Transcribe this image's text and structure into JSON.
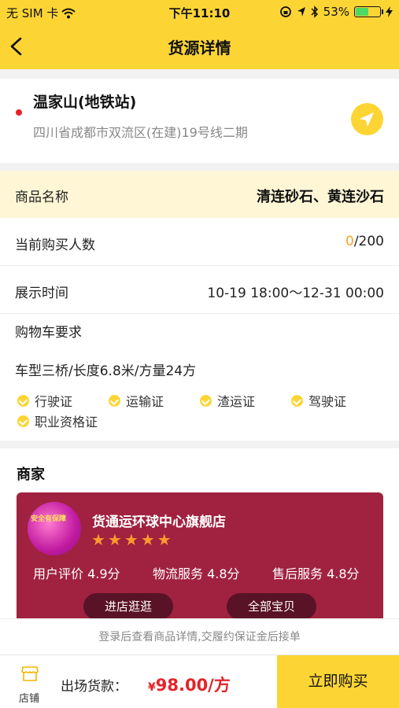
{
  "status_bar": {
    "carrier": "无 SIM 卡",
    "time": "下午11:10",
    "battery": "53%",
    "battery_level": 0.53
  },
  "nav": {
    "title": "货源详情"
  },
  "location": {
    "name": "温家山(地铁站)",
    "address": "四川省成都市双流区(在建)19号线二期"
  },
  "details": {
    "product_label": "商品名称",
    "product_value": "清连砂石、黄连沙石",
    "buyers_label": "当前购买人数",
    "buyers_current": "0",
    "buyers_total": "/200",
    "time_label": "展示时间",
    "time_value": "10-19 18:00～12-31 00:00"
  },
  "cart": {
    "title": "购物车要求",
    "spec": "车型三桥/长度6.8米/方量24方",
    "certs": [
      "行驶证",
      "运输证",
      "渣运证",
      "驾驶证",
      "职业资格证"
    ]
  },
  "merchant": {
    "section_title": "商家",
    "shop_name": "货通运环球中心旗舰店",
    "avatar_text": "安全有保障",
    "stars": 5,
    "ratings": [
      "用户评价 4.9分",
      "物流服务 4.8分",
      "售后服务 4.8分"
    ],
    "enter_shop": "进店逛逛",
    "all_items": "全部宝贝"
  },
  "notice": "登录后查看商品详情,交履约保证金后接单",
  "bottom": {
    "store_label": "店铺",
    "price_label": "出场货款：",
    "price_symbol": "¥",
    "price_value": "98.00/方",
    "buy_label": "立即购买"
  },
  "colors": {
    "accent": "#fcd535",
    "shop_card": "#a02240",
    "price": "#e5232a",
    "star": "#ff9a2e"
  }
}
